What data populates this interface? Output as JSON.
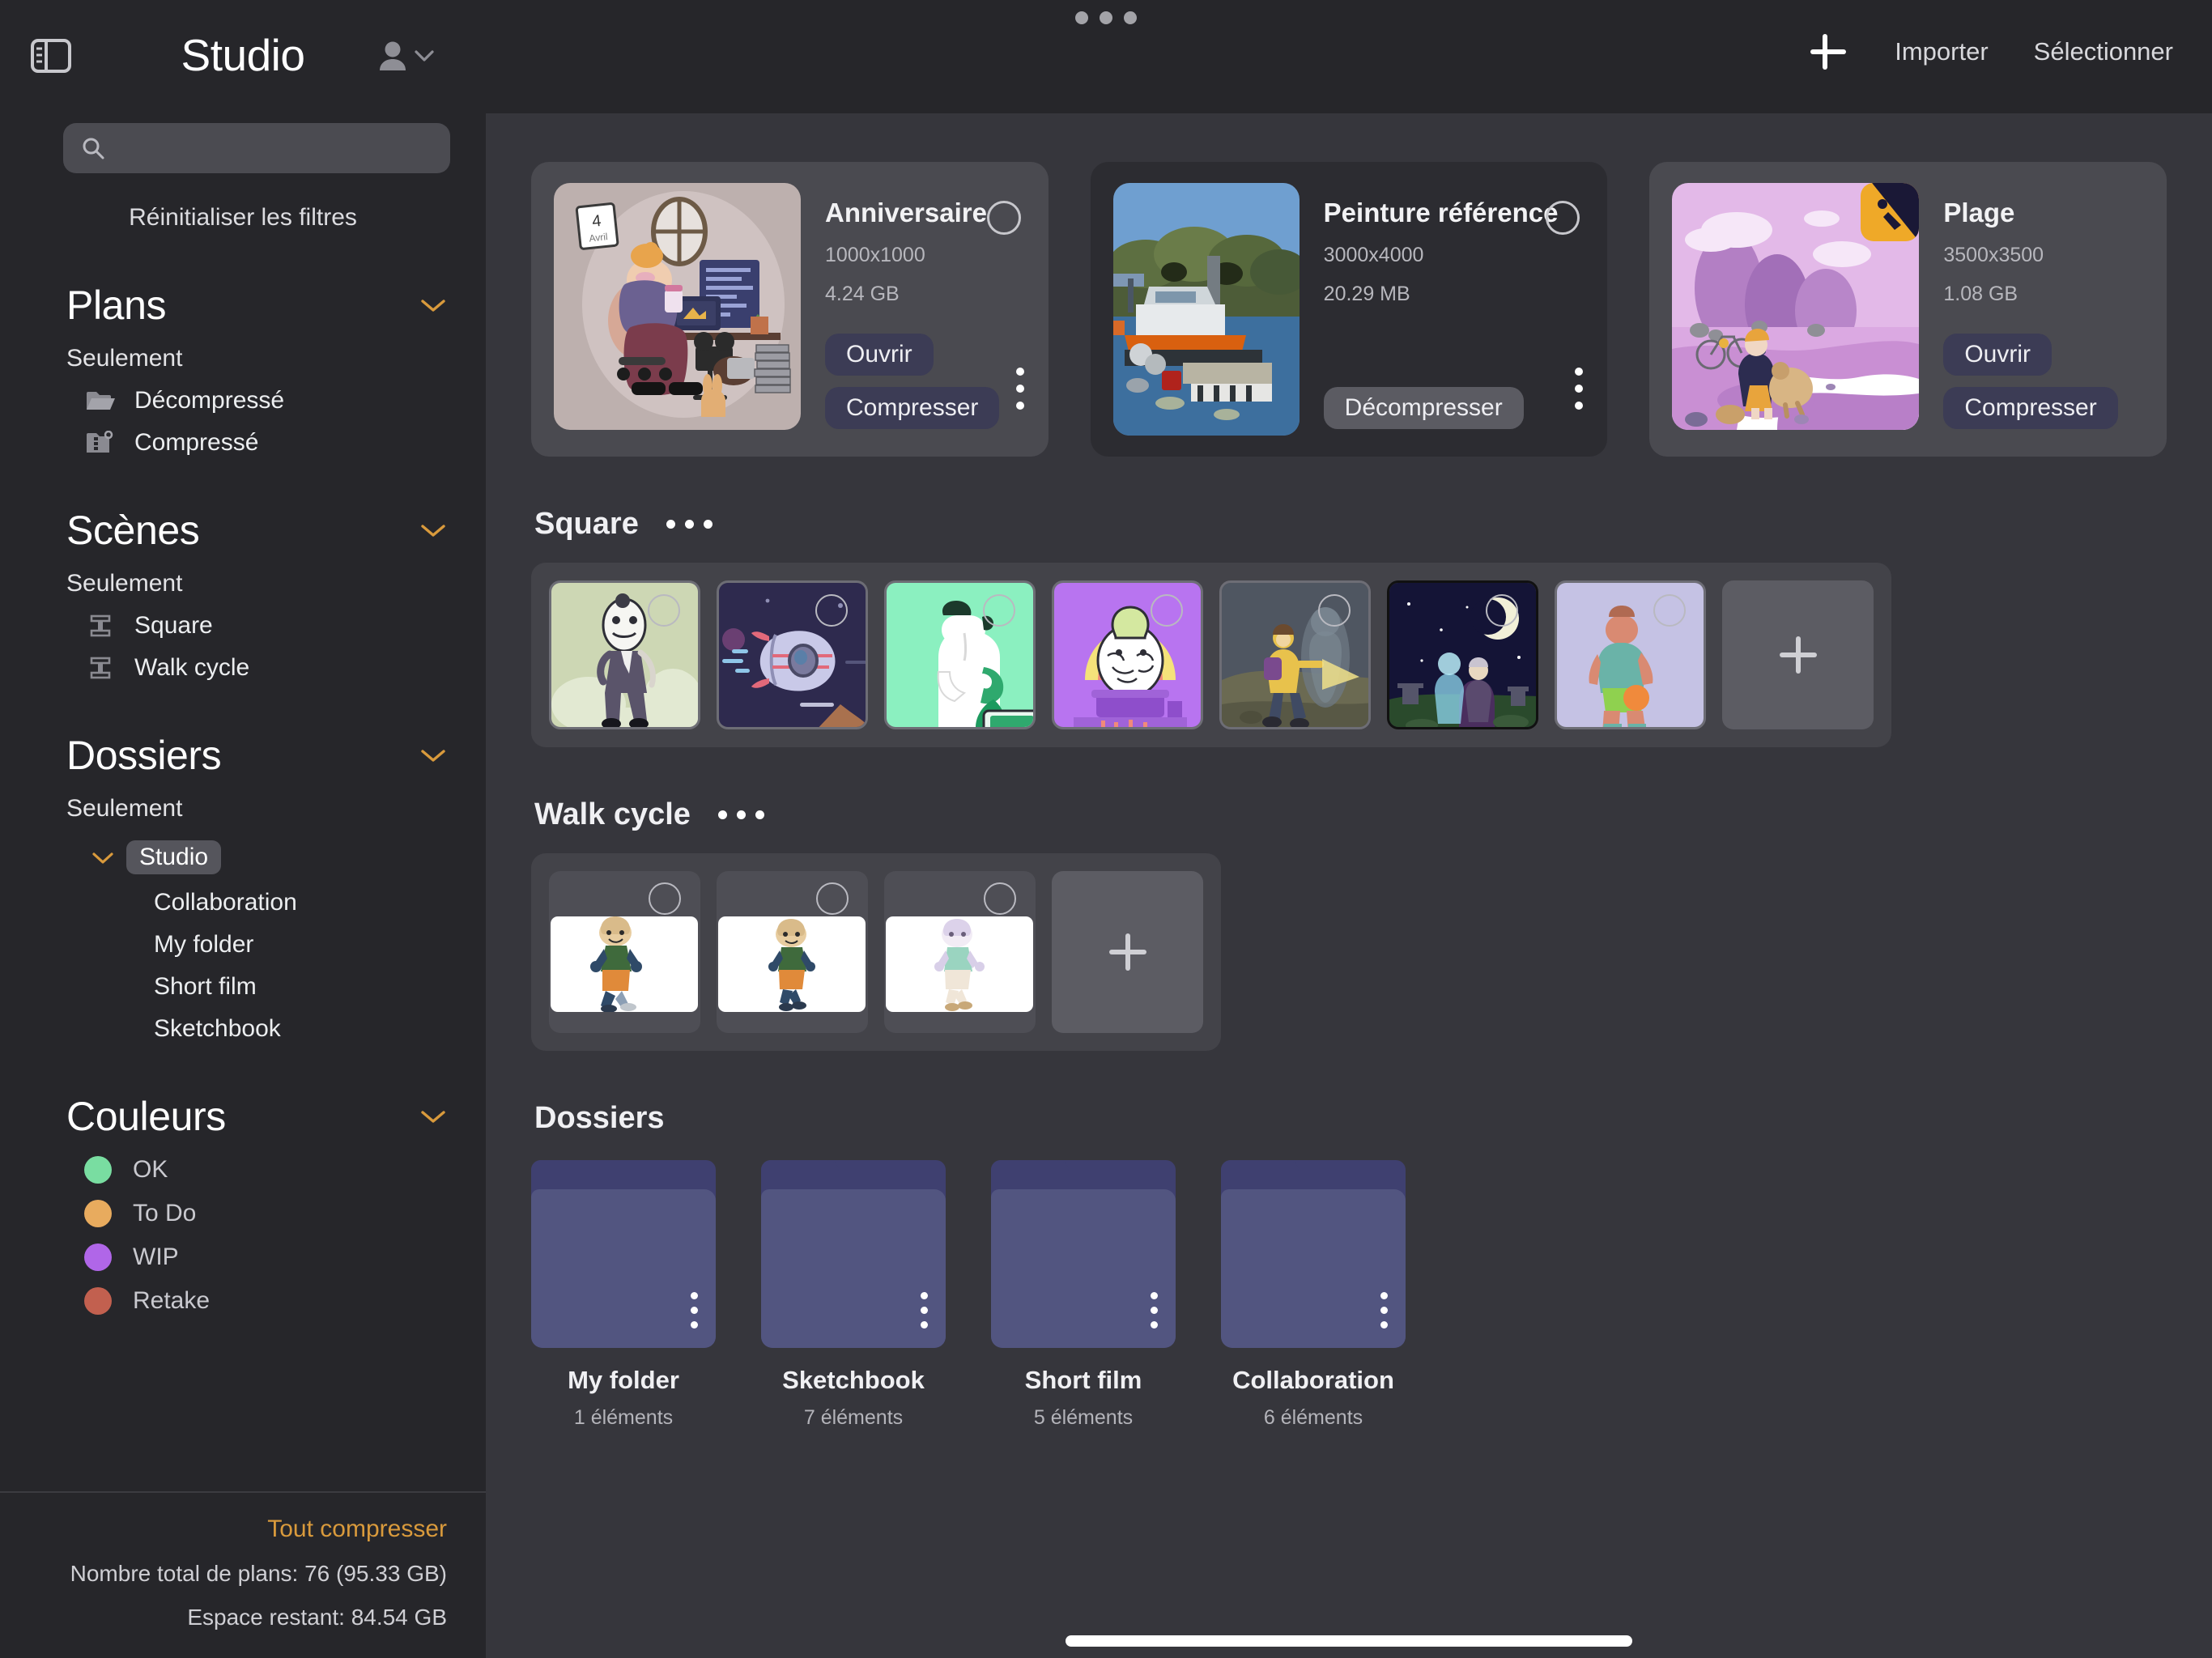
{
  "window": {
    "drag_handle": "drag-dots"
  },
  "header": {
    "title": "Studio",
    "sidebar_toggle_icon": "sidebar-toggle-icon",
    "account_icon": "person-icon",
    "account_chevron_icon": "chevron-down-icon",
    "add_icon": "plus-icon",
    "import_label": "Importer",
    "select_label": "Sélectionner"
  },
  "sidebar": {
    "search": {
      "value": "",
      "placeholder": "",
      "icon": "search-icon"
    },
    "reset_filters_label": "Réinitialiser les filtres",
    "groups": [
      {
        "title": "Plans",
        "only_label": "Seulement",
        "items": [
          {
            "label": "Décompressé",
            "icon": "open-folder-icon"
          },
          {
            "label": "Compressé",
            "icon": "zipped-folder-icon"
          }
        ]
      },
      {
        "title": "Scènes",
        "only_label": "Seulement",
        "items": [
          {
            "label": "Square",
            "icon": "film-strip-icon"
          },
          {
            "label": "Walk cycle",
            "icon": "film-strip-icon"
          }
        ]
      }
    ],
    "folders_group": {
      "title": "Dossiers",
      "only_label": "Seulement",
      "root": "Studio",
      "children": [
        "Collaboration",
        "My folder",
        "Short film",
        "Sketchbook"
      ]
    },
    "colors_group": {
      "title": "Couleurs",
      "items": [
        {
          "label": "OK",
          "color": "#79dda1"
        },
        {
          "label": "To Do",
          "color": "#e8ab5e"
        },
        {
          "label": "WIP",
          "color": "#b066e8"
        },
        {
          "label": "Retake",
          "color": "#c2604f"
        }
      ]
    },
    "footer": {
      "compress_all_label": "Tout compresser",
      "total_label": "Nombre total de plans: 76 (95.33 GB)",
      "space_label": "Espace restant: 84.54 GB"
    }
  },
  "main": {
    "cards": [
      {
        "name": "Anniversaire",
        "dimensions": "1000x1000",
        "size": "4.24 GB",
        "buttons": [
          "Ouvrir",
          "Compresser"
        ],
        "button_style": "blue",
        "card_style": "light",
        "thumb": "illustration-birthday",
        "radio": "selection-radio",
        "kebab": "more-options-icon"
      },
      {
        "name": "Peinture référence",
        "dimensions": "3000x4000",
        "size": "20.29 MB",
        "buttons": [
          "Décompresser"
        ],
        "button_style": "grey",
        "card_style": "dark",
        "thumb": "photo-boat-harbour",
        "radio": "selection-radio",
        "kebab": "more-options-icon"
      },
      {
        "name": "Plage",
        "dimensions": "3500x3500",
        "size": "1.08 GB",
        "buttons": [
          "Ouvrir",
          "Compresser"
        ],
        "button_style": "blue",
        "card_style": "light",
        "thumb": "illustration-beach",
        "badge": "app-badge-icon",
        "kebab": "more-options-icon"
      }
    ],
    "scene_sections": [
      {
        "title": "Square",
        "menu_icon": "more-options-icon",
        "add_label": "+",
        "tiles": [
          {
            "name": "square-shot-1"
          },
          {
            "name": "square-shot-2"
          },
          {
            "name": "square-shot-3"
          },
          {
            "name": "square-shot-4"
          },
          {
            "name": "square-shot-5"
          },
          {
            "name": "square-shot-6"
          },
          {
            "name": "square-shot-7"
          }
        ]
      },
      {
        "title": "Walk cycle",
        "menu_icon": "more-options-icon",
        "add_label": "+",
        "tiles": [
          {
            "name": "walk-shot-1"
          },
          {
            "name": "walk-shot-2"
          },
          {
            "name": "walk-shot-3"
          }
        ]
      }
    ],
    "folders_section": {
      "title": "Dossiers",
      "folders": [
        {
          "name": "My folder",
          "count": "1 éléments"
        },
        {
          "name": "Sketchbook",
          "count": "7 éléments"
        },
        {
          "name": "Short film",
          "count": "5 éléments"
        },
        {
          "name": "Collaboration",
          "count": "6 éléments"
        }
      ]
    }
  },
  "colors": {
    "accent": "#d99a3c",
    "sidebar_bg": "#26262a",
    "main_bg": "#36363c",
    "card_light": "#4a4a50",
    "card_dark": "#2c2c31",
    "button_blue": "#3c3c55",
    "folder": "#525580"
  }
}
